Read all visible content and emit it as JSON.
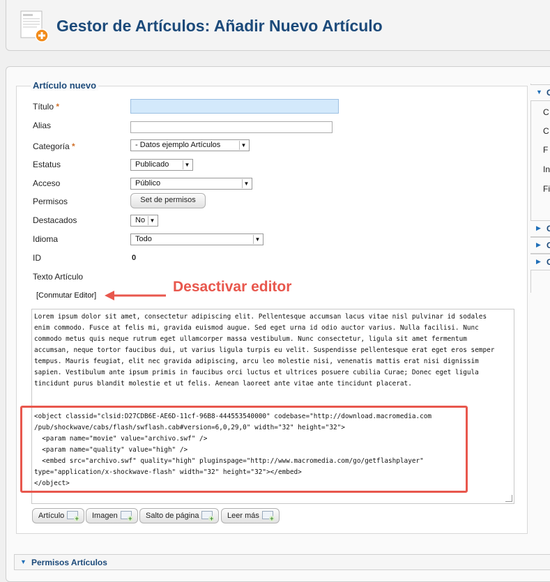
{
  "page": {
    "title": "Gestor de Artículos: Añadir Nuevo Artículo"
  },
  "form": {
    "legend": "Artículo nuevo",
    "fields": {
      "titulo": {
        "label": "Título",
        "value": ""
      },
      "alias": {
        "label": "Alias",
        "value": ""
      },
      "categoria": {
        "label": "Categoría",
        "value": "- Datos ejemplo Artículos"
      },
      "estatus": {
        "label": "Estatus",
        "value": "Publicado"
      },
      "acceso": {
        "label": "Acceso",
        "value": "Público"
      },
      "permisos": {
        "label": "Permisos",
        "button": "Set de permisos"
      },
      "destacados": {
        "label": "Destacados",
        "value": "No"
      },
      "idioma": {
        "label": "Idioma",
        "value": "Todo"
      },
      "id": {
        "label": "ID",
        "value": "0"
      },
      "texto": {
        "label": "Texto Artículo"
      }
    },
    "required_mark": "*",
    "toggle_editor": "[Conmutar Editor]",
    "annotation": "Desactivar editor"
  },
  "editor": {
    "text": "Lorem ipsum dolor sit amet, consectetur adipiscing elit. Pellentesque accumsan lacus vitae nisl pulvinar id sodales enim commodo. Fusce at felis mi, gravida euismod augue. Sed eget urna id odio auctor varius. Nulla facilisi. Nunc commodo metus quis neque rutrum eget ullamcorper massa vestibulum. Nunc consectetur, ligula sit amet fermentum accumsan, neque tortor faucibus dui, ut varius ligula turpis eu velit. Suspendisse pellentesque erat eget eros semper tempus. Mauris feugiat, elit nec gravida adipiscing, arcu leo molestie nisi, venenatis mattis erat nisi dignissim sapien. Vestibulum ante ipsum primis in faucibus orci luctus et ultrices posuere cubilia Curae; Donec eget ligula tincidunt purus blandit molestie et ut felis. Aenean laoreet ante vitae ante tincidunt placerat.",
    "code": "<object classid=\"clsid:D27CDB6E-AE6D-11cf-96B8-444553540000\" codebase=\"http://download.macromedia.com\n/pub/shockwave/cabs/flash/swflash.cab#version=6,0,29,0\" width=\"32\" height=\"32\">\n  <param name=\"movie\" value=\"archivo.swf\" />\n  <param name=\"quality\" value=\"high\" />\n  <embed src=\"archivo.swf\" quality=\"high\" pluginspage=\"http://www.macromedia.com/go/getflashplayer\"\ntype=\"application/x-shockwave-flash\" width=\"32\" height=\"32\"></embed>\n</object>"
  },
  "editor_buttons": [
    "Artículo",
    "Imagen",
    "Salto de página",
    "Leer más"
  ],
  "sidebar": {
    "panel_heads": [
      "C",
      "C",
      "C",
      "C"
    ],
    "rows": [
      "C",
      "C",
      "F",
      "In",
      "Fi"
    ]
  },
  "bottom_panel": {
    "title": "Permisos Artículos"
  },
  "colors": {
    "title_blue": "#1c4a7a",
    "annotation_red": "#e8574d",
    "accent_blue": "#1f6fb8"
  }
}
